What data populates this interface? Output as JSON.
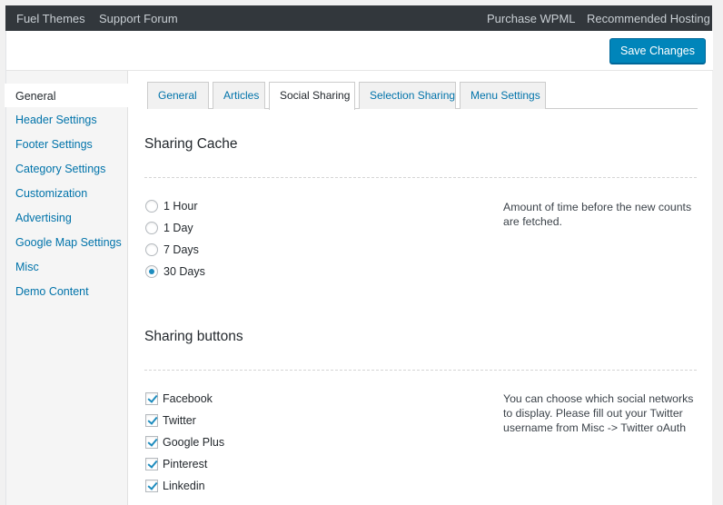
{
  "topbar": {
    "left_links": [
      "Fuel Themes",
      "Support Forum"
    ],
    "right_links": [
      "Purchase WPML",
      "Recommended Hosting"
    ]
  },
  "header": {
    "save_label": "Save Changes"
  },
  "sidebar": {
    "items": [
      {
        "label": "General",
        "active": true
      },
      {
        "label": "Header Settings",
        "active": false
      },
      {
        "label": "Footer Settings",
        "active": false
      },
      {
        "label": "Category Settings",
        "active": false
      },
      {
        "label": "Customization",
        "active": false
      },
      {
        "label": "Advertising",
        "active": false
      },
      {
        "label": "Google Map Settings",
        "active": false
      },
      {
        "label": "Misc",
        "active": false
      },
      {
        "label": "Demo Content",
        "active": false
      }
    ]
  },
  "tabs": [
    {
      "label": "General",
      "active": false
    },
    {
      "label": "Articles",
      "active": false
    },
    {
      "label": "Social Sharing",
      "active": true
    },
    {
      "label": "Selection Sharing",
      "active": false
    },
    {
      "label": "Menu Settings",
      "active": false
    }
  ],
  "sharing_cache": {
    "title": "Sharing Cache",
    "options": [
      {
        "label": "1 Hour",
        "checked": false
      },
      {
        "label": "1 Day",
        "checked": false
      },
      {
        "label": "7 Days",
        "checked": false
      },
      {
        "label": "30 Days",
        "checked": true
      }
    ],
    "description": "Amount of time before the new counts are fetched."
  },
  "sharing_buttons": {
    "title": "Sharing buttons",
    "options": [
      {
        "label": "Facebook",
        "checked": true
      },
      {
        "label": "Twitter",
        "checked": true
      },
      {
        "label": "Google Plus",
        "checked": true
      },
      {
        "label": "Pinterest",
        "checked": true
      },
      {
        "label": "Linkedin",
        "checked": true
      }
    ],
    "description": "You can choose which social networks to display. Please fill out your Twitter username from Misc -> Twitter oAuth"
  },
  "colors": {
    "accent": "#0073aa",
    "button": "#0085ba",
    "topbar": "#32373c"
  }
}
